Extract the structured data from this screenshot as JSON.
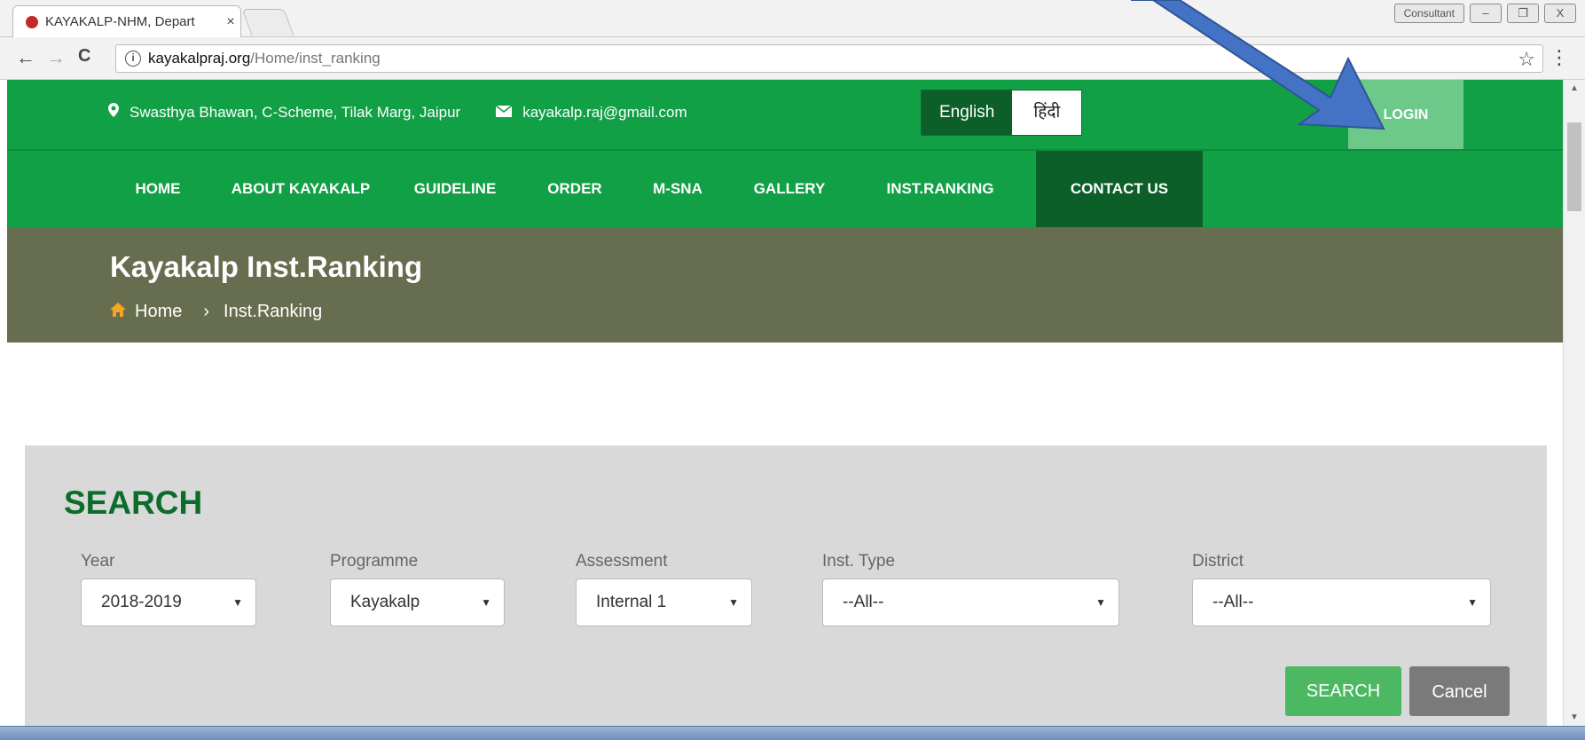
{
  "browser": {
    "tab_title": "KAYAKALP-NHM, Depart",
    "tab_close": "×",
    "badge": "Consultant",
    "min": "–",
    "restore": "❐",
    "close": "X",
    "back": "←",
    "forward": "→",
    "reload": "C",
    "info": "i",
    "url_host": "kayakalpraj.org",
    "url_path": "/Home/inst_ranking",
    "star": "☆",
    "menu": "⋮"
  },
  "topbar": {
    "address": "Swasthya Bhawan, C-Scheme, Tilak Marg, Jaipur",
    "email": "kayakalp.raj@gmail.com",
    "lang_en": "English",
    "lang_hi": "हिंदी",
    "login": "LOGIN",
    "pin_icon": "pin-icon",
    "mail_icon": "envelope-icon"
  },
  "nav": {
    "items": [
      "HOME",
      "ABOUT KAYAKALP",
      "GUIDELINE",
      "ORDER",
      "M-SNA",
      "GALLERY",
      "INST.RANKING",
      "CONTACT US"
    ],
    "active": "CONTACT US"
  },
  "banner": {
    "title": "Kayakalp Inst.Ranking",
    "breadcrumb_home": "Home",
    "breadcrumb_sep": "›",
    "breadcrumb_current": "Inst.Ranking"
  },
  "search": {
    "heading": "SEARCH",
    "fields": [
      {
        "label": "Year",
        "value": "2018-2019"
      },
      {
        "label": "Programme",
        "value": "Kayakalp"
      },
      {
        "label": "Assessment",
        "value": "Internal 1"
      },
      {
        "label": "Inst. Type",
        "value": "--All--"
      },
      {
        "label": "District",
        "value": "--All--"
      }
    ],
    "caret": "▼",
    "search_button": "SEARCH",
    "cancel_button": "Cancel"
  },
  "colors": {
    "brand_green": "#12a046",
    "dark_green": "#0c5f28",
    "banner_olive": "#676e4f",
    "login_light": "#6cc98a",
    "arrow_blue": "#4472c4"
  }
}
